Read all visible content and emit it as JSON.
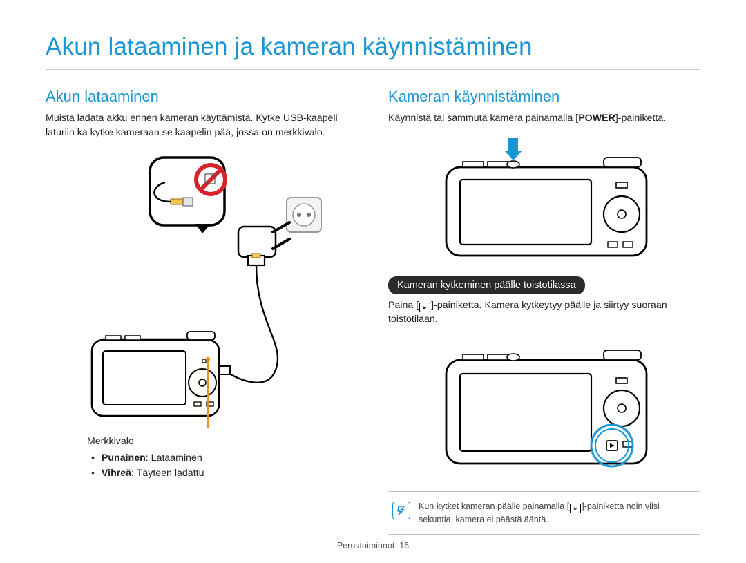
{
  "page_title": "Akun lataaminen ja kameran käynnistäminen",
  "left": {
    "heading": "Akun lataaminen",
    "intro": "Muista ladata akku ennen kameran käyttämistä. Kytke USB-kaapeli laturiin ka kytke kameraan se kaapelin pää, jossa on merkkivalo.",
    "legend": {
      "title": "Merkkivalo",
      "red_label": "Punainen",
      "red_desc": ": Lataaminen",
      "green_label": "Vihreä",
      "green_desc": ": Täyteen ladattu"
    }
  },
  "right": {
    "heading": "Kameran käynnistäminen",
    "intro_prefix": "Käynnistä tai sammuta kamera painamalla [",
    "power_label": "POWER",
    "intro_suffix": "]-painiketta.",
    "subheader": "Kameran kytkeminen päälle toistotilassa",
    "play_prefix": "Paina [",
    "play_suffix": "]-painiketta. Kamera kytkeytyy päälle ja siirtyy suoraan toistotilaan.",
    "note_prefix": "Kun kytket kameran päälle painamalla [",
    "note_suffix": "]-painiketta noin viisi sekuntia, kamera ei päästä ääntä."
  },
  "footer": {
    "section": "Perustoiminnot",
    "page_number": "16"
  }
}
